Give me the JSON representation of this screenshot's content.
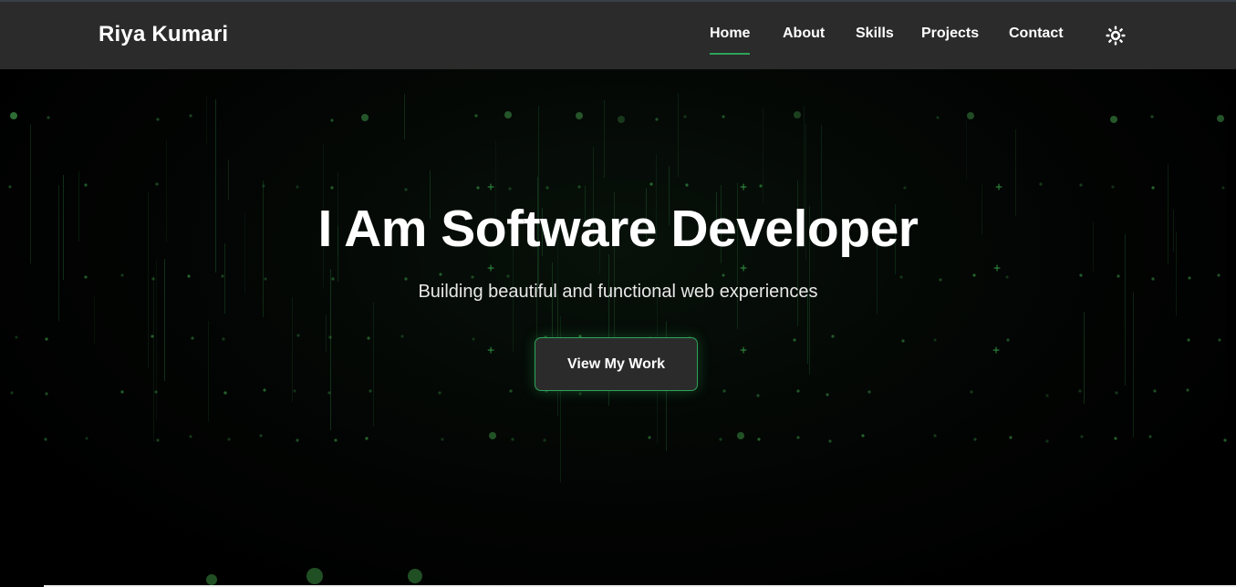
{
  "header": {
    "brand": "Riya Kumari",
    "nav": [
      {
        "label": "Home",
        "active": true
      },
      {
        "label": "About",
        "active": false
      },
      {
        "label": "Skills",
        "active": false
      },
      {
        "label": "Projects",
        "active": false
      },
      {
        "label": "Contact",
        "active": false
      }
    ],
    "theme_toggle_icon": "sun-icon"
  },
  "hero": {
    "title": "I Am Software Developer",
    "subtitle": "Building beautiful and functional web experiences",
    "cta_label": "View My Work"
  },
  "colors": {
    "navbar_bg": "#2b2b2b",
    "accent": "#2ea35a",
    "hero_bg": "#000000",
    "text": "#ffffff"
  }
}
